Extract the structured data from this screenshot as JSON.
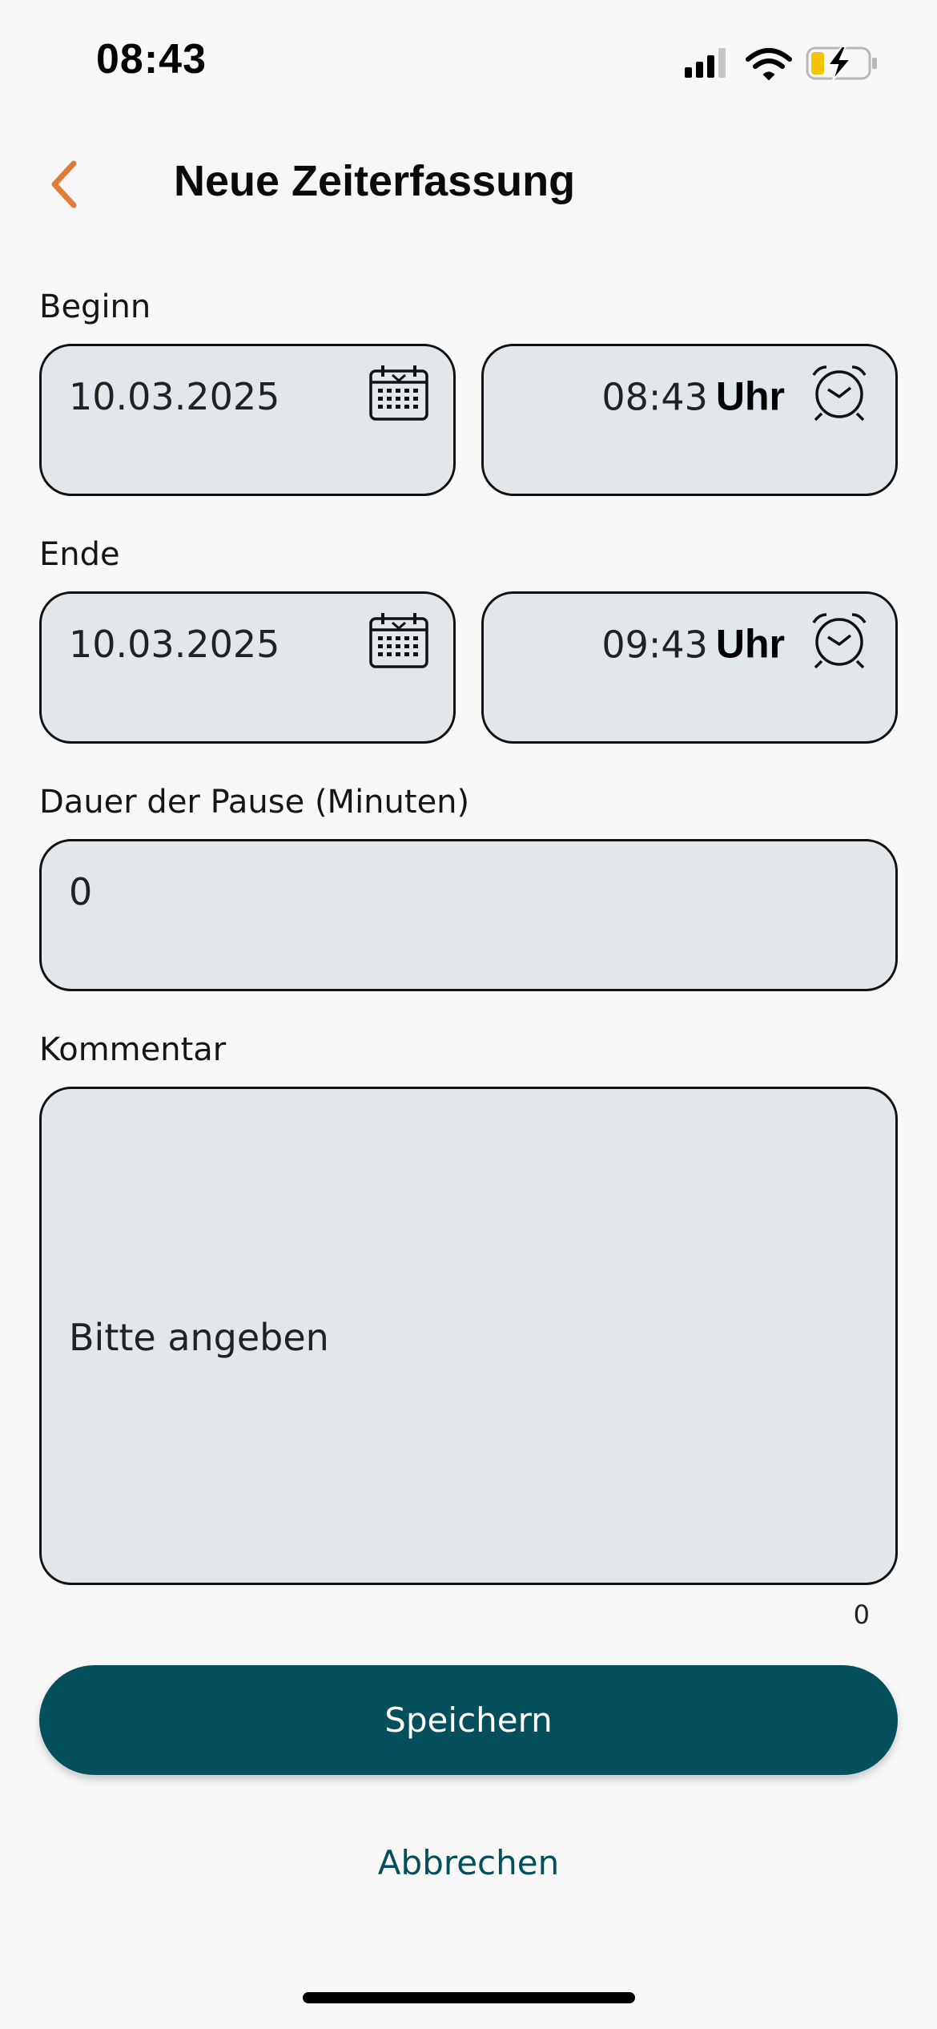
{
  "status_bar": {
    "time": "08:43"
  },
  "header": {
    "title": "Neue Zeiterfassung",
    "back_icon": "chevron-left-icon"
  },
  "form": {
    "start": {
      "label": "Beginn",
      "date": "10.03.2025",
      "time": "08:43",
      "time_unit": "Uhr"
    },
    "end": {
      "label": "Ende",
      "date": "10.03.2025",
      "time": "09:43",
      "time_unit": "Uhr"
    },
    "pause": {
      "label": "Dauer der Pause (Minuten)",
      "value": "0"
    },
    "comment": {
      "label": "Kommentar",
      "placeholder": "Bitte angeben",
      "char_count": "0"
    }
  },
  "actions": {
    "save_label": "Speichern",
    "cancel_label": "Abbrechen"
  },
  "colors": {
    "accent": "#034f5c",
    "back_arrow": "#e07b39",
    "field_bg": "#e1e7ea",
    "battery_fill": "#f5c400"
  }
}
